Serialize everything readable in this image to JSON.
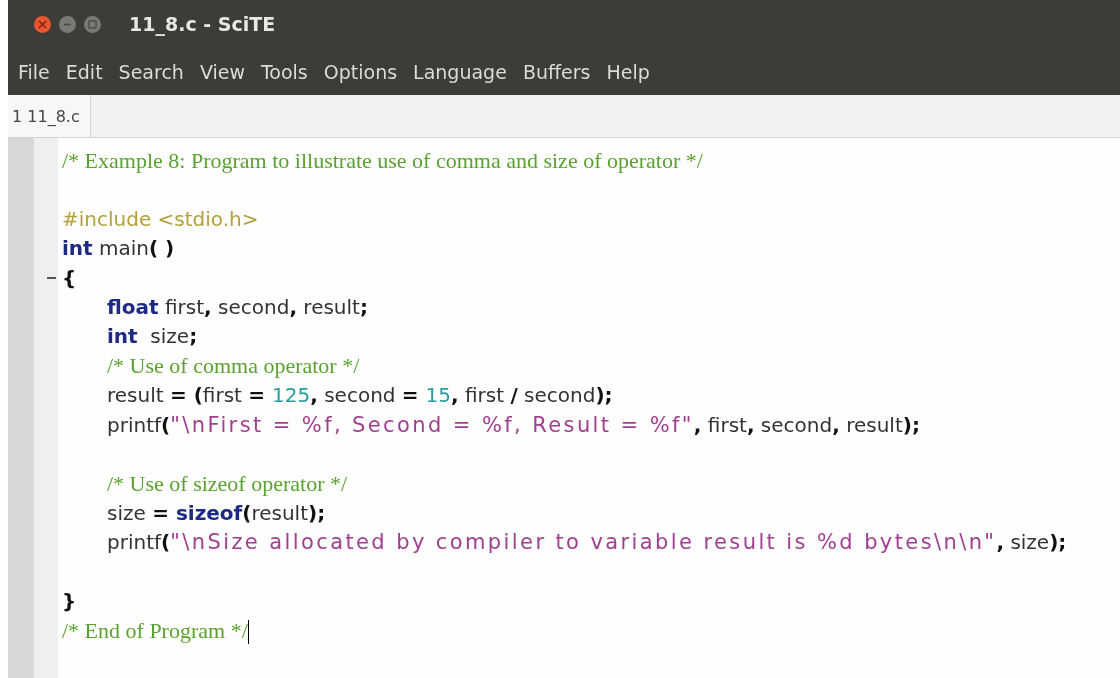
{
  "window": {
    "title": "11_8.c - SciTE"
  },
  "menu": [
    "File",
    "Edit",
    "Search",
    "View",
    "Tools",
    "Options",
    "Language",
    "Buffers",
    "Help"
  ],
  "tabs": [
    {
      "label": "1 11_8.c",
      "selected": true
    }
  ],
  "editor": {
    "lines": [
      {
        "fold": false,
        "caret": false,
        "tokens": [
          {
            "kind": "comment",
            "text": "/* Example 8: Program to illustrate use of comma and size of operator */"
          }
        ]
      },
      {
        "fold": false,
        "caret": false
      },
      {
        "fold": false,
        "caret": false,
        "tokens": [
          {
            "kind": "preproc",
            "text": "#include <stdio.h>"
          }
        ]
      },
      {
        "fold": false,
        "caret": false,
        "tokens": [
          {
            "kind": "keyword",
            "text": "int"
          },
          {
            "kind": "plain",
            "text": " main"
          },
          {
            "kind": "operator",
            "text": "( )"
          }
        ]
      },
      {
        "fold": true,
        "caret": false,
        "tokens": [
          {
            "kind": "operator",
            "text": "{"
          }
        ],
        "children": [
          {
            "fold": false,
            "caret": false,
            "tokens": [
              {
                "kind": "keyword",
                "text": "float"
              },
              {
                "kind": "plain",
                "text": " first"
              },
              {
                "kind": "operator",
                "text": ","
              },
              {
                "kind": "plain",
                "text": " second"
              },
              {
                "kind": "operator",
                "text": ","
              },
              {
                "kind": "plain",
                "text": " result"
              },
              {
                "kind": "operator",
                "text": ";"
              }
            ]
          },
          {
            "fold": false,
            "caret": false,
            "tokens": [
              {
                "kind": "keyword",
                "text": "int"
              },
              {
                "kind": "plain",
                "text": "  size"
              },
              {
                "kind": "operator",
                "text": ";"
              }
            ]
          },
          {
            "fold": false,
            "caret": false,
            "tokens": [
              {
                "kind": "comment",
                "text": "/* Use of comma operator */"
              }
            ]
          },
          {
            "fold": false,
            "caret": false,
            "tokens": [
              {
                "kind": "plain",
                "text": "result "
              },
              {
                "kind": "operator",
                "text": "= ("
              },
              {
                "kind": "plain",
                "text": "first "
              },
              {
                "kind": "operator",
                "text": "= "
              },
              {
                "kind": "number",
                "text": "125"
              },
              {
                "kind": "operator",
                "text": ","
              },
              {
                "kind": "plain",
                "text": " second "
              },
              {
                "kind": "operator",
                "text": "= "
              },
              {
                "kind": "number",
                "text": "15"
              },
              {
                "kind": "operator",
                "text": ","
              },
              {
                "kind": "plain",
                "text": " first "
              },
              {
                "kind": "operator",
                "text": "/"
              },
              {
                "kind": "plain",
                "text": " second"
              },
              {
                "kind": "operator",
                "text": ");"
              }
            ]
          },
          {
            "fold": false,
            "caret": false,
            "tokens": [
              {
                "kind": "plain",
                "text": "printf"
              },
              {
                "kind": "operator",
                "text": "("
              },
              {
                "kind": "string",
                "text": "\"\\nFirst = %f, Second = %f, Result = %f\""
              },
              {
                "kind": "operator",
                "text": ","
              },
              {
                "kind": "plain",
                "text": " first"
              },
              {
                "kind": "operator",
                "text": ","
              },
              {
                "kind": "plain",
                "text": " second"
              },
              {
                "kind": "operator",
                "text": ","
              },
              {
                "kind": "plain",
                "text": " result"
              },
              {
                "kind": "operator",
                "text": ");"
              }
            ]
          },
          {
            "fold": false,
            "caret": false
          },
          {
            "fold": false,
            "caret": false,
            "tokens": [
              {
                "kind": "comment",
                "text": "/* Use of sizeof operator */"
              }
            ]
          },
          {
            "fold": false,
            "caret": false,
            "tokens": [
              {
                "kind": "plain",
                "text": "size "
              },
              {
                "kind": "operator",
                "text": "= "
              },
              {
                "kind": "keyword",
                "text": "sizeof"
              },
              {
                "kind": "operator",
                "text": "("
              },
              {
                "kind": "plain",
                "text": "result"
              },
              {
                "kind": "operator",
                "text": ");"
              }
            ]
          },
          {
            "fold": false,
            "caret": false,
            "tokens": [
              {
                "kind": "plain",
                "text": "printf"
              },
              {
                "kind": "operator",
                "text": "("
              },
              {
                "kind": "string",
                "text": "\"\\nSize allocated by compiler to variable result is %d bytes\\n\\n\""
              },
              {
                "kind": "operator",
                "text": ","
              },
              {
                "kind": "plain",
                "text": " size"
              },
              {
                "kind": "operator",
                "text": ");"
              }
            ]
          },
          {
            "fold": false,
            "caret": false
          }
        ]
      },
      {
        "fold": false,
        "caret": false,
        "tokens": [
          {
            "kind": "operator",
            "text": "}"
          }
        ]
      },
      {
        "fold": false,
        "caret": true,
        "tokens": [
          {
            "kind": "comment",
            "text": "/* End of Program */"
          }
        ]
      }
    ]
  }
}
